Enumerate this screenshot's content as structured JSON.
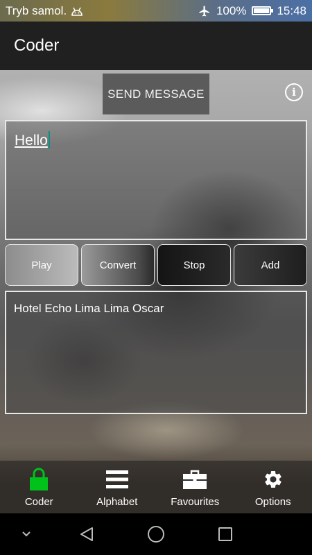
{
  "status_bar": {
    "mode_text": "Tryb samol.",
    "battery_percent": "100%",
    "battery_level": 1.0,
    "time": "15:48",
    "icons": [
      "android-debug-icon",
      "airplane-icon",
      "battery-icon"
    ]
  },
  "app_bar": {
    "title": "Coder"
  },
  "toolbar": {
    "send_label": "SEND MESSAGE",
    "info_icon": "info-icon"
  },
  "input": {
    "value": "Hello"
  },
  "buttons": {
    "play": "Play",
    "convert": "Convert",
    "stop": "Stop",
    "add": "Add"
  },
  "output": {
    "value": "Hotel Echo Lima Lima Oscar"
  },
  "bottom_nav": {
    "items": [
      {
        "label": "Coder",
        "icon": "lock-icon",
        "color": "#00c21b"
      },
      {
        "label": "Alphabet",
        "icon": "menu-icon",
        "color": "#ffffff"
      },
      {
        "label": "Favourites",
        "icon": "briefcase-icon",
        "color": "#ffffff"
      },
      {
        "label": "Options",
        "icon": "gear-icon",
        "color": "#ffffff"
      }
    ]
  },
  "system_nav": {
    "icons": [
      "chevron-down-icon",
      "back-icon",
      "home-icon",
      "recents-icon"
    ]
  }
}
